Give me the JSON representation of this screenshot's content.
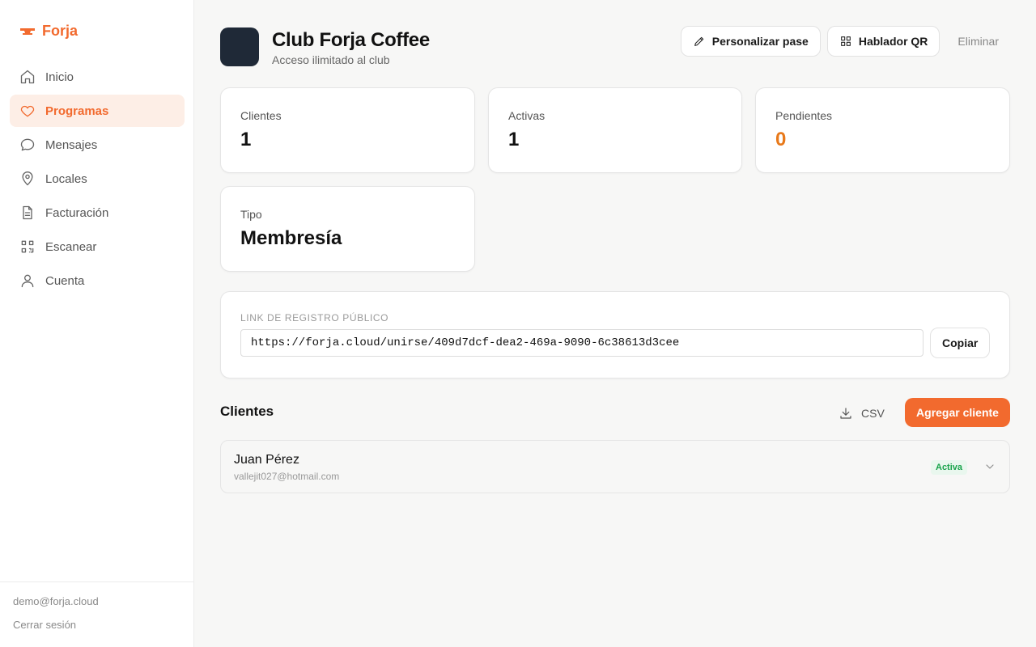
{
  "sidebar": {
    "brand": "Forja",
    "items": [
      {
        "label": "Inicio",
        "icon": "home-icon"
      },
      {
        "label": "Programas",
        "icon": "heart-icon",
        "active": true
      },
      {
        "label": "Mensajes",
        "icon": "message-icon"
      },
      {
        "label": "Locales",
        "icon": "map-pin-icon"
      },
      {
        "label": "Facturación",
        "icon": "file-text-icon"
      },
      {
        "label": "Escanear",
        "icon": "scan-icon"
      },
      {
        "label": "Cuenta",
        "icon": "user-icon"
      }
    ],
    "user_email": "demo@forja.cloud",
    "logout_label": "Cerrar sesión"
  },
  "header": {
    "title": "Club Forja Coffee",
    "subtitle": "Acceso ilimitado al club",
    "customize_label": "Personalizar pase",
    "qr_label": "Hablador QR",
    "delete_label": "Eliminar"
  },
  "stats": {
    "clients_label": "Clientes",
    "clients_value": "1",
    "active_label": "Activas",
    "active_value": "1",
    "pending_label": "Pendientes",
    "pending_value": "0",
    "type_label": "Tipo",
    "type_value": "Membresía"
  },
  "registration": {
    "label": "LINK DE REGISTRO PÚBLICO",
    "url": "https://forja.cloud/unirse/409d7dcf-dea2-469a-9090-6c38613d3cee",
    "copy_label": "Copiar"
  },
  "clients": {
    "title": "Clientes",
    "csv_label": "CSV",
    "add_label": "Agregar cliente",
    "rows": [
      {
        "name": "Juan Pérez",
        "email": "vallejit027@hotmail.com",
        "status": "Activa"
      }
    ]
  },
  "colors": {
    "accent": "#f26a2e",
    "pending": "#e8791a",
    "active_badge": "#17a34a"
  }
}
